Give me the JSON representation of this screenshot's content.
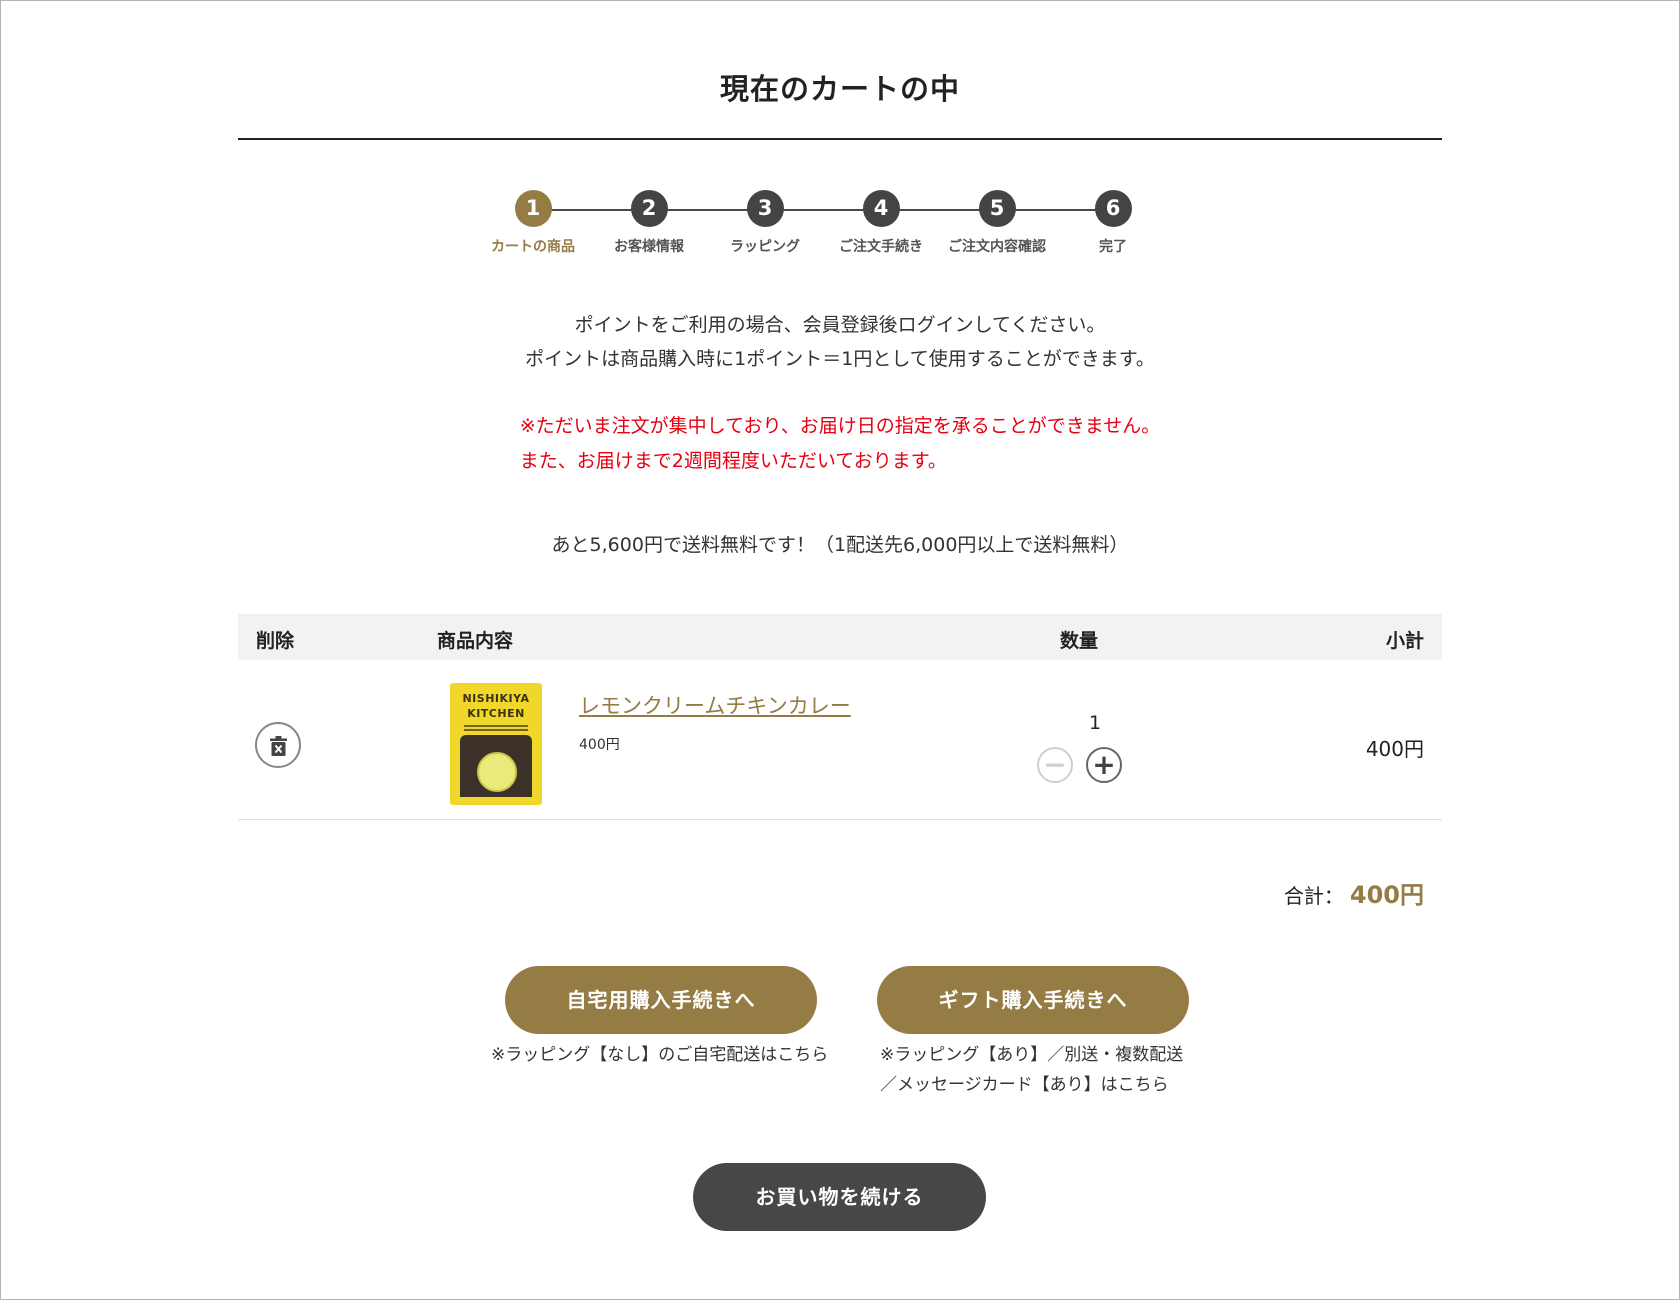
{
  "page": {
    "title": "現在のカートの中"
  },
  "steps": [
    {
      "num": "1",
      "label": "カートの商品"
    },
    {
      "num": "2",
      "label": "お客様情報"
    },
    {
      "num": "3",
      "label": "ラッピング"
    },
    {
      "num": "4",
      "label": "ご注文手続き"
    },
    {
      "num": "5",
      "label": "ご注文内容確認"
    },
    {
      "num": "6",
      "label": "完了"
    }
  ],
  "active_step": 1,
  "notice": {
    "line1": "ポイントをご利用の場合、会員登録後ログインしてください。",
    "line2": "ポイントは商品購入時に1ポイント＝1円として使用することができます。"
  },
  "warning": {
    "line1": "※ただいま注文が集中しており、お届け日の指定を承ることができません。",
    "line2": "また、お届けまで2週間程度いただいております。"
  },
  "shipping_message": "あと5,600円で送料無料です！（1配送先6,000円以上で送料無料）",
  "table": {
    "headers": {
      "delete": "削除",
      "item": "商品内容",
      "qty": "数量",
      "subtotal": "小計"
    },
    "rows": [
      {
        "name": "レモンクリームチキンカレー",
        "price": "400円",
        "qty": "1",
        "subtotal": "400円",
        "image_brand_line1": "NISHIKIYA",
        "image_brand_line2": "KITCHEN"
      }
    ]
  },
  "total": {
    "label": "合計：",
    "value": "400円"
  },
  "buttons": {
    "home": "自宅用購入手続きへ",
    "home_note": "※ラッピング【なし】のご自宅配送はこちら",
    "gift": "ギフト購入手続きへ",
    "gift_note_line1": "※ラッピング【あり】／別送・複数配送",
    "gift_note_line2": "／メッセージカード【あり】はこちら",
    "continue": "お買い物を続ける"
  },
  "colors": {
    "accent": "#957b44",
    "warning": "#e60012",
    "dark_button": "#474747",
    "step_inactive": "#444444"
  },
  "icons": {
    "delete": "trash-icon",
    "qty_minus": "minus-icon",
    "qty_plus": "plus-icon"
  }
}
